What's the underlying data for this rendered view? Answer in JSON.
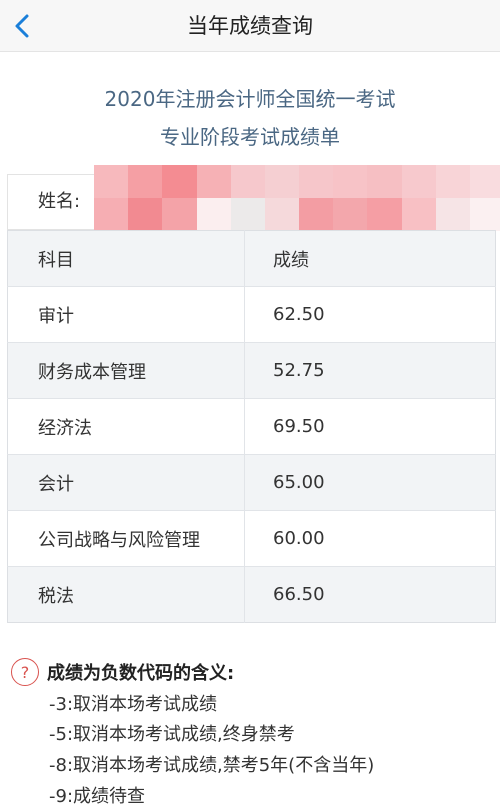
{
  "header": {
    "title": "当年成绩查询"
  },
  "report": {
    "title_line1": "2020年注册会计师全国统一考试",
    "title_line2": "专业阶段考试成绩单",
    "name_label": "姓名:"
  },
  "table": {
    "header": {
      "subject": "科目",
      "score": "成绩"
    },
    "rows": [
      {
        "subject": "审计",
        "score": "62.50"
      },
      {
        "subject": "财务成本管理",
        "score": "52.75"
      },
      {
        "subject": "经济法",
        "score": "69.50"
      },
      {
        "subject": "会计",
        "score": "65.00"
      },
      {
        "subject": "公司战略与风险管理",
        "score": "60.00"
      },
      {
        "subject": "税法",
        "score": "66.50"
      }
    ]
  },
  "notes": {
    "title": "成绩为负数代码的含义:",
    "items": [
      "-3:取消本场考试成绩",
      "-5:取消本场考试成绩,终身禁考",
      "-8:取消本场考试成绩,禁考5年(不含当年)",
      "-9:成绩待查"
    ]
  },
  "colors": {
    "accent": "#1a7fd9",
    "title_text": "#4a6783",
    "table_header_bg": "#f2f4f6",
    "help_icon": "#d9534f"
  },
  "icons": {
    "back": "chevron-left-icon",
    "help": "question-circle-icon"
  }
}
